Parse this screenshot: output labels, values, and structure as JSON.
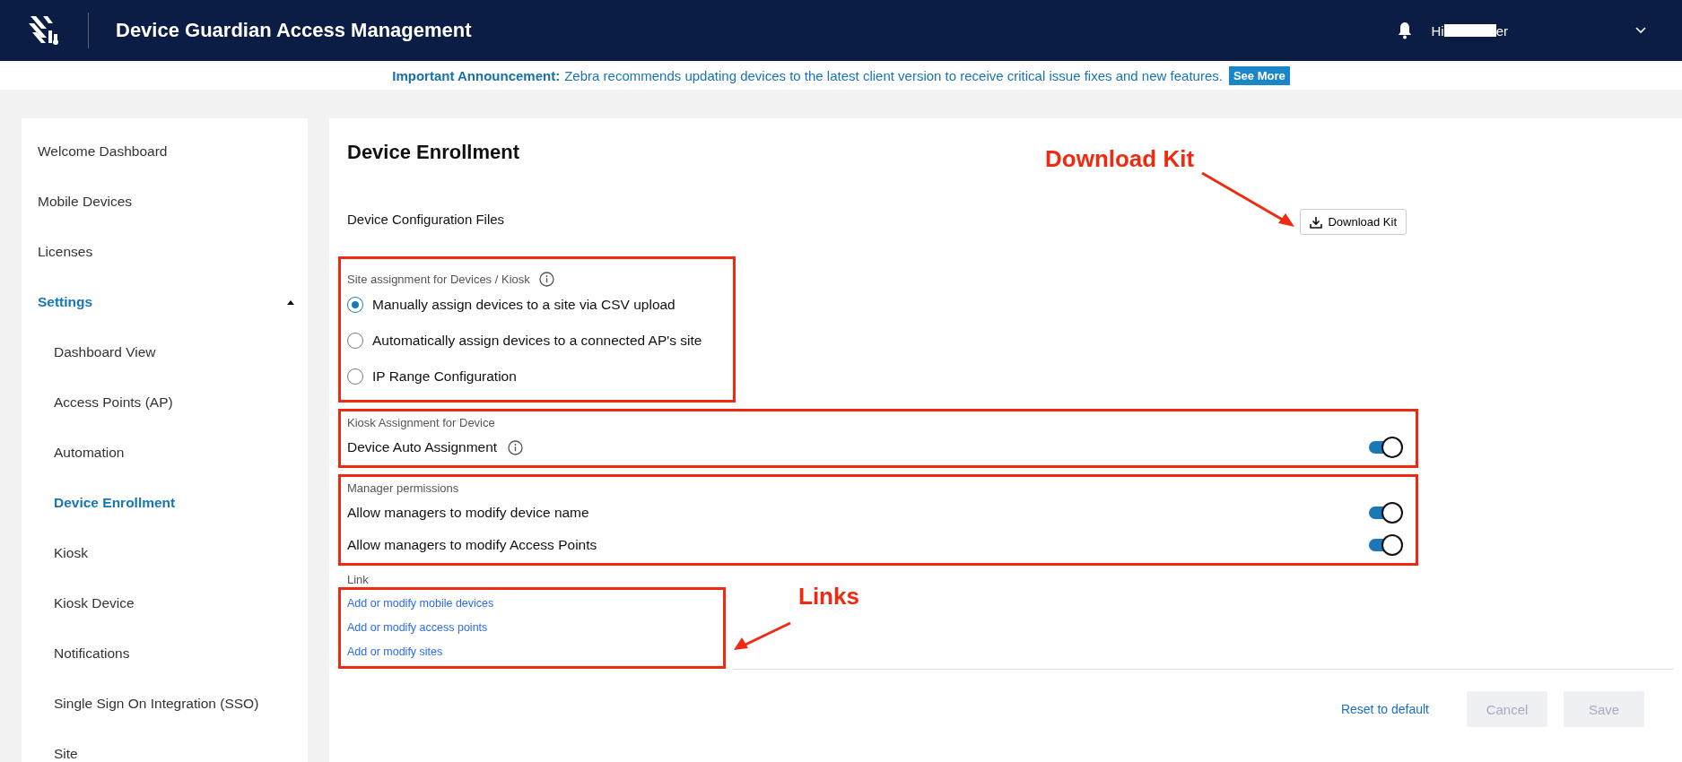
{
  "header": {
    "title": "Device Guardian Access Management",
    "greeting": "Hi",
    "name_end": "er"
  },
  "announcement": {
    "label": "Important Announcement:",
    "message": "Zebra recommends updating devices to the latest client version to receive critical issue fixes and new features.",
    "button": "See More"
  },
  "sidebar": {
    "items": [
      {
        "label": "Welcome Dashboard",
        "selected": false
      },
      {
        "label": "Mobile Devices",
        "selected": false
      },
      {
        "label": "Licenses",
        "selected": false
      },
      {
        "label": "Settings",
        "selected": true,
        "expanded": true,
        "children": [
          {
            "label": "Dashboard View",
            "selected": false
          },
          {
            "label": "Access Points (AP)",
            "selected": false
          },
          {
            "label": "Automation",
            "selected": false
          },
          {
            "label": "Device Enrollment",
            "selected": true
          },
          {
            "label": "Kiosk",
            "selected": false
          },
          {
            "label": "Kiosk Device",
            "selected": false
          },
          {
            "label": "Notifications",
            "selected": false
          },
          {
            "label": "Single Sign On Integration (SSO)",
            "selected": false
          },
          {
            "label": "Site",
            "selected": false
          }
        ]
      }
    ]
  },
  "main": {
    "title": "Device Enrollment",
    "config_label": "Device Configuration Files",
    "download_button": "Download Kit",
    "site_assignment": {
      "label": "Site assignment for Devices / Kiosk",
      "info": true,
      "options": [
        {
          "label": "Manually assign devices to a site via CSV upload",
          "selected": true
        },
        {
          "label": "Automatically assign devices to a connected AP's site",
          "selected": false
        },
        {
          "label": "IP Range Configuration",
          "selected": false
        }
      ]
    },
    "kiosk_assignment": {
      "label": "Kiosk Assignment for Device",
      "toggles": [
        {
          "label": "Device Auto Assignment",
          "info": true,
          "on": true
        }
      ]
    },
    "manager_permissions": {
      "label": "Manager permissions",
      "toggles": [
        {
          "label": "Allow managers to modify device name",
          "info": false,
          "on": true
        },
        {
          "label": "Allow managers to modify Access Points",
          "info": false,
          "on": true
        }
      ]
    },
    "links": {
      "label": "Link",
      "items": [
        "Add or modify mobile devices",
        "Add or modify access points",
        "Add or modify sites"
      ]
    },
    "footer": {
      "reset": "Reset to default",
      "cancel": {
        "label": "Cancel",
        "disabled": true
      },
      "save": {
        "label": "Save",
        "disabled": true
      }
    }
  },
  "annotations": [
    {
      "kind": "download",
      "label": "Download Kit"
    },
    {
      "kind": "links",
      "label": "Links"
    }
  ]
}
